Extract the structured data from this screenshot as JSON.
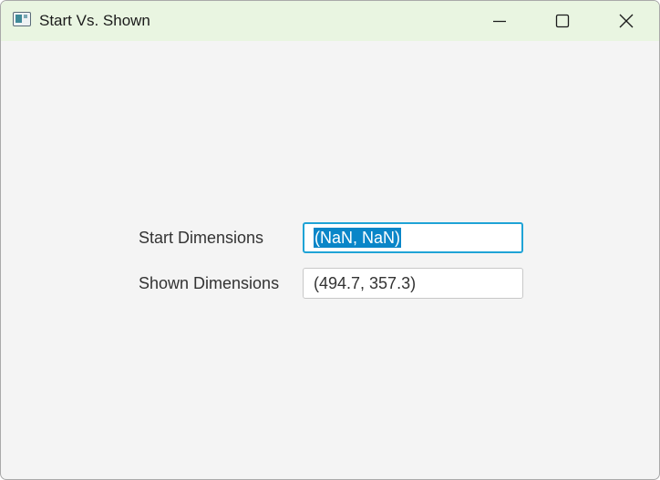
{
  "window": {
    "title": "Start Vs. Shown",
    "icon": "app-window-icon",
    "controls": {
      "minimize_icon": "minimize-icon",
      "maximize_icon": "maximize-icon",
      "close_icon": "close-icon"
    },
    "titlebar_color": "#e9f5e1",
    "background_color": "#f4f4f4"
  },
  "form": {
    "start": {
      "label": "Start Dimensions",
      "value": "(NaN, NaN)",
      "focused": true,
      "text_selected": true
    },
    "shown": {
      "label": "Shown Dimensions",
      "value": "(494.7, 357.3)"
    },
    "focus_color": "#1fa3d6",
    "selection_color": "#0a86c8"
  }
}
